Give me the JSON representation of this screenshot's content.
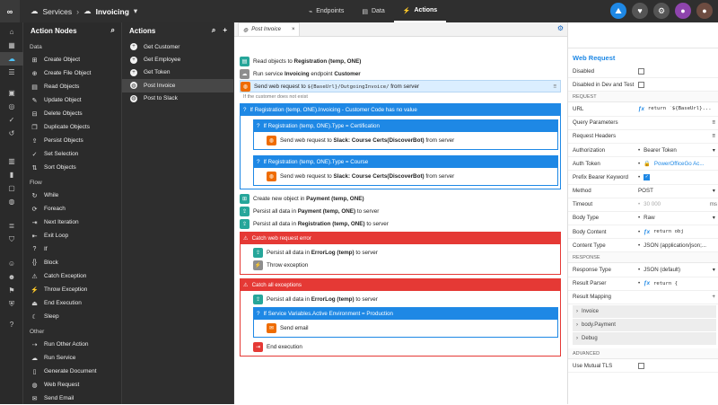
{
  "app": {
    "logo": "∞",
    "crumb_services": "Services",
    "crumb_project": "Invoicing"
  },
  "nav_tabs": [
    {
      "label": "Endpoints",
      "icon": "endpoints-icon"
    },
    {
      "label": "Data",
      "icon": "data-icon"
    },
    {
      "label": "Actions",
      "icon": "actions-icon"
    }
  ],
  "nodes_panel": {
    "title": "Action Nodes",
    "data_group": "Data",
    "data_items": [
      "Create Object",
      "Create File Object",
      "Read Objects",
      "Update Object",
      "Delete Objects",
      "Duplicate Objects",
      "Persist Objects",
      "Set Selection",
      "Sort Objects"
    ],
    "flow_group": "Flow",
    "flow_items": [
      "While",
      "Foreach",
      "Next Iteration",
      "Exit Loop",
      "If",
      "Block",
      "Catch Exception",
      "Throw Exception",
      "End Execution",
      "Sleep"
    ],
    "other_group": "Other",
    "other_items": [
      "Run Other Action",
      "Run Service",
      "Generate Document",
      "Web Request",
      "Send Email"
    ]
  },
  "actions_panel": {
    "title": "Actions",
    "items": [
      "Get Customer",
      "Get Employee",
      "Get Token",
      "Post Invoice",
      "Post to Slack"
    ],
    "selected": "Post Invoice"
  },
  "editor": {
    "tab_label": "Post Invoice",
    "step1_a": "Read objects to ",
    "step1_b": "Registration (temp, ONE)",
    "step2_a": "Run service ",
    "step2_b": "Invoicing",
    "step2_c": " endpoint ",
    "step2_d": "Customer",
    "step3_a": "Send web request to ",
    "step3_b": "${BaseUrl}/OutgoingInvoice/",
    "step3_c": " from server",
    "note": "If the customer does not exist",
    "if1": "If Registration (temp, ONE).Invoicing - Customer Code has no value",
    "if2": "If Registration (temp, ONE).Type = Certification",
    "if2_step_a": "Send web request to ",
    "if2_step_b": "Slack: Course Certs(DiscoverBot)",
    "if2_step_c": " from server",
    "if3": "If Registration (temp, ONE).Type = Course",
    "if3_step_a": "Send web request to ",
    "if3_step_b": "Slack: Course Certs(DiscoverBot)",
    "if3_step_c": " from server",
    "step4_a": "Create new object in ",
    "step4_b": "Payment (temp, ONE)",
    "step5_a": "Persist all data in ",
    "step5_b": "Payment (temp, ONE)",
    "step5_c": " to server",
    "step6_a": "Persist all data in ",
    "step6_b": "Registration (temp, ONE)",
    "step6_c": " to server",
    "catch1": "Catch web request error",
    "catch1_s1_a": "Persist all data in ",
    "catch1_s1_b": "ErrorLog (temp)",
    "catch1_s1_c": " to server",
    "catch1_s2": "Throw exception",
    "catch2": "Catch all exceptions",
    "catch2_s1_a": "Persist all data in ",
    "catch2_s1_b": "ErrorLog (temp)",
    "catch2_s1_c": " to server",
    "if4": "If Service Variables.Active Environment = Production",
    "if4_step": "Send email",
    "end": "End execution"
  },
  "props": {
    "title": "Web Request",
    "disabled": "Disabled",
    "disabled_dev": "Disabled in Dev and Test",
    "sec_request": "REQUEST",
    "url_label": "URL",
    "url_value": "return `${BaseUrl}...",
    "qp_label": "Query Parameters",
    "rh_label": "Request Headers",
    "auth_label": "Authorization",
    "auth_value": "Bearer Token",
    "token_label": "Auth Token",
    "token_value": "PowerOfficeGo Ac...",
    "prefix_label": "Prefix Bearer Keyword",
    "method_label": "Method",
    "method_value": "POST",
    "timeout_label": "Timeout",
    "timeout_value": "30 000",
    "timeout_unit": "ms",
    "bodytype_label": "Body Type",
    "bodytype_value": "Raw",
    "bodycontent_label": "Body Content",
    "bodycontent_value": "return obj",
    "ctype_label": "Content Type",
    "ctype_value": "JSON (application/json;...",
    "sec_response": "RESPONSE",
    "rtype_label": "Response Type",
    "rtype_value": "JSON (default)",
    "parser_label": "Result Parser",
    "parser_value": "return {",
    "mapping_label": "Result Mapping",
    "mappings": [
      "Invoice",
      "body.Payment",
      "Debug"
    ],
    "sec_advanced": "ADVANCED",
    "mtls_label": "Use Mutual TLS",
    "fx": "ƒx"
  }
}
